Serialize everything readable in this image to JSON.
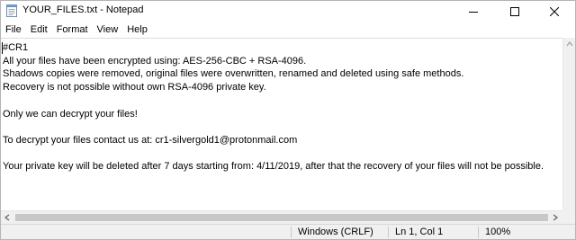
{
  "window": {
    "title": "YOUR_FILES.txt - Notepad"
  },
  "menu": {
    "items": [
      "File",
      "Edit",
      "Format",
      "View",
      "Help"
    ]
  },
  "editor": {
    "content": "#CR1\nAll your files have been encrypted using: AES-256-CBC + RSA-4096.\nShadows copies were removed, original files were overwritten, renamed and deleted using safe methods.\nRecovery is not possible without own RSA-4096 private key.\n\nOnly we can decrypt your files!\n\nTo decrypt your files contact us at: cr1-silvergold1@protonmail.com\n\nYour private key will be deleted after 7 days starting from: 4/11/2019, after that the recovery of your files will not be possible."
  },
  "statusbar": {
    "encoding": "Windows (CRLF)",
    "position": "Ln 1, Col 1",
    "zoom": "100%"
  }
}
